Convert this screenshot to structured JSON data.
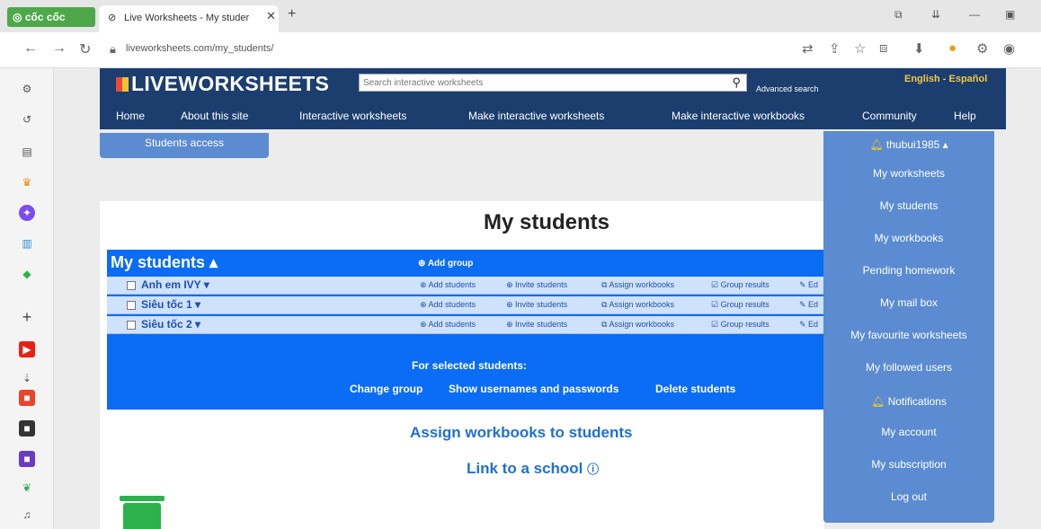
{
  "browser": {
    "brand": "cốc cốc",
    "tab_title": "Live Worksheets - My studer",
    "tab_close": "✕",
    "new_tab": "+",
    "url": "liveworksheets.com/my_students/"
  },
  "site": {
    "logo": "LIVEWORKSHEETS",
    "search_placeholder": "Search interactive worksheets",
    "advanced_search": "Advanced search",
    "languages": "English - Español",
    "menu": [
      "Home",
      "About this site",
      "Interactive worksheets",
      "Make interactive worksheets",
      "Make interactive workbooks",
      "Community",
      "Help"
    ],
    "students_access": "Students access"
  },
  "main": {
    "title": "My students",
    "my_students_label": "My students ▴",
    "add_group": "Add group",
    "groups": [
      {
        "name": "Anh em IVY ▾"
      },
      {
        "name": "Siêu tốc 1 ▾"
      },
      {
        "name": "Siêu tốc 2 ▾"
      }
    ],
    "group_actions": [
      "Add students",
      "Invite students",
      "Assign workbooks",
      "Group results",
      "Ed"
    ],
    "for_selected": "For selected students:",
    "selected_actions": [
      "Change group",
      "Show usernames and passwords",
      "Delete students"
    ],
    "assign_workbooks": "Assign workbooks to students",
    "link_school": "Link to a school"
  },
  "dropdown": {
    "user": "thubui1985 ▴",
    "items": [
      "My worksheets",
      "My students",
      "My workbooks",
      "Pending homework",
      "My mail box",
      "My favourite worksheets",
      "My followed users",
      "Notifications",
      "My account",
      "My subscription",
      "Log out"
    ]
  }
}
